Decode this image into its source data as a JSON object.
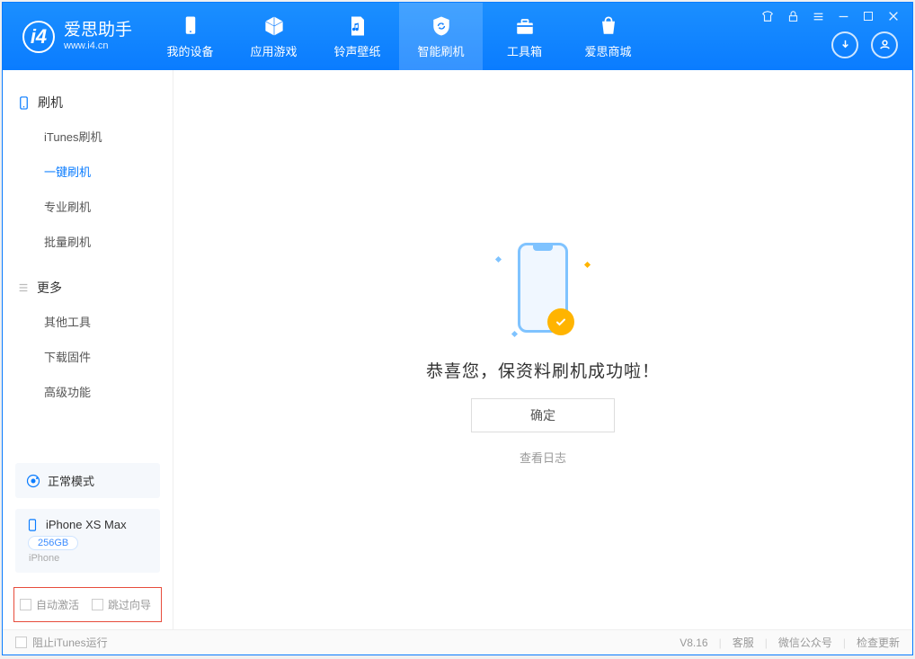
{
  "app": {
    "title": "爱思助手",
    "subtitle": "www.i4.cn"
  },
  "nav": {
    "tabs": [
      {
        "label": "我的设备"
      },
      {
        "label": "应用游戏"
      },
      {
        "label": "铃声壁纸"
      },
      {
        "label": "智能刷机"
      },
      {
        "label": "工具箱"
      },
      {
        "label": "爱思商城"
      }
    ]
  },
  "sidebar": {
    "group1": {
      "title": "刷机",
      "items": [
        "iTunes刷机",
        "一键刷机",
        "专业刷机",
        "批量刷机"
      ]
    },
    "group2": {
      "title": "更多",
      "items": [
        "其他工具",
        "下载固件",
        "高级功能"
      ]
    },
    "mode": "正常模式",
    "device": {
      "name": "iPhone XS Max",
      "capacity": "256GB",
      "type": "iPhone"
    },
    "opts": {
      "auto_activate": "自动激活",
      "skip_guide": "跳过向导"
    }
  },
  "main": {
    "message": "恭喜您，保资料刷机成功啦！",
    "ok": "确定",
    "log": "查看日志"
  },
  "footer": {
    "block_itunes": "阻止iTunes运行",
    "version": "V8.16",
    "links": [
      "客服",
      "微信公众号",
      "检查更新"
    ]
  }
}
